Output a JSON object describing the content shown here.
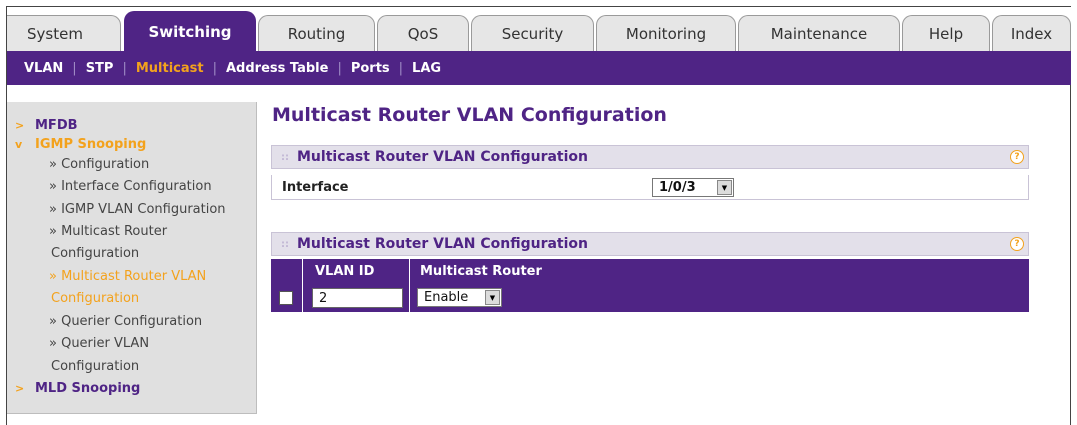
{
  "tabs": [
    {
      "label": "System",
      "active": false
    },
    {
      "label": "Switching",
      "active": true
    },
    {
      "label": "Routing",
      "active": false
    },
    {
      "label": "QoS",
      "active": false
    },
    {
      "label": "Security",
      "active": false
    },
    {
      "label": "Monitoring",
      "active": false
    },
    {
      "label": "Maintenance",
      "active": false
    },
    {
      "label": "Help",
      "active": false
    },
    {
      "label": "Index",
      "active": false
    }
  ],
  "subnav": [
    {
      "label": "VLAN",
      "active": false
    },
    {
      "label": "STP",
      "active": false
    },
    {
      "label": "Multicast",
      "active": true
    },
    {
      "label": "Address Table",
      "active": false
    },
    {
      "label": "Ports",
      "active": false
    },
    {
      "label": "LAG",
      "active": false
    }
  ],
  "sidebar": {
    "mfdb": "MFDB",
    "igmp_snooping": "IGMP Snooping",
    "items": [
      "» Configuration",
      "» Interface Configuration",
      "» IGMP VLAN Configuration",
      "» Multicast Router",
      "Configuration",
      "» Multicast Router VLAN",
      "Configuration",
      "» Querier Configuration",
      "» Querier VLAN",
      "Configuration"
    ],
    "mld_snooping": "MLD Snooping",
    "mark_closed": ">",
    "mark_open": "v"
  },
  "page_title": "Multicast Router VLAN Configuration",
  "panel1": {
    "title": "Multicast Router VLAN Configuration",
    "interface_label": "Interface",
    "interface_value": "1/0/3"
  },
  "panel2": {
    "title": "Multicast Router VLAN Configuration",
    "columns": [
      "VLAN ID",
      "Multicast Router"
    ],
    "row": {
      "vlan_id": "2",
      "multicast_router": "Enable",
      "checked": false
    }
  },
  "icons": {
    "help": "?",
    "dropdown": "▼",
    "panel_dots": "::"
  },
  "colors": {
    "brand_purple": "#4f2485",
    "accent_orange": "#f3a21d"
  }
}
